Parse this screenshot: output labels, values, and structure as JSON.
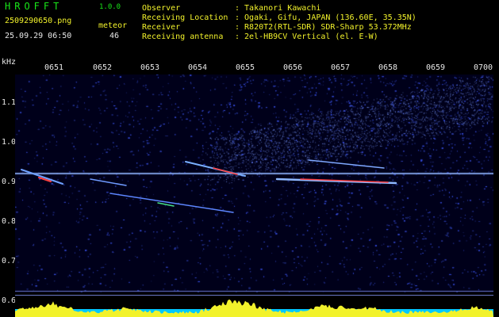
{
  "header": {
    "app_title": "HROFFT",
    "app_version": "1.0.0",
    "file_name": "2509290650.png",
    "timestamp": "25.09.29 06:50",
    "meteor_label": "meteor",
    "meteor_count": "46"
  },
  "info": {
    "rows": [
      {
        "label": "Observer",
        "value": ": Takanori Kawachi"
      },
      {
        "label": "Receiving Location",
        "value": ": Ogaki, Gifu, JAPAN (136.60E, 35.35N)"
      },
      {
        "label": "Receiver",
        "value": ": R820T2(RTL-SDR) SDR-Sharp 53.372MHz"
      },
      {
        "label": "Receiving antenna",
        "value": ": 2el-HB9CV Vertical (el. E-W)"
      }
    ]
  },
  "axes": {
    "y_unit": "kHz",
    "time_labels": [
      "0651",
      "0652",
      "0653",
      "0654",
      "0655",
      "0656",
      "0657",
      "0658",
      "0659",
      "0700"
    ],
    "freq_labels": [
      "1.1",
      "1.0",
      "0.9",
      "0.8",
      "0.7",
      "0.6"
    ]
  },
  "spectrogram": {
    "time_range_minutes": [
      0,
      10
    ],
    "freq_range_khz": [
      0.6,
      1.15
    ],
    "carrier_khz": 0.9,
    "colors": {
      "background": "#00001a",
      "noise": "#2a3cff",
      "echo": "#ff4040",
      "carrier": "#8fb4ff",
      "axis_text": "#e8e8e8",
      "title_text": "#19e619",
      "info_text": "#f2f22b",
      "audio_level": "#f2f22b",
      "audio_base": "#00c8ff"
    }
  }
}
